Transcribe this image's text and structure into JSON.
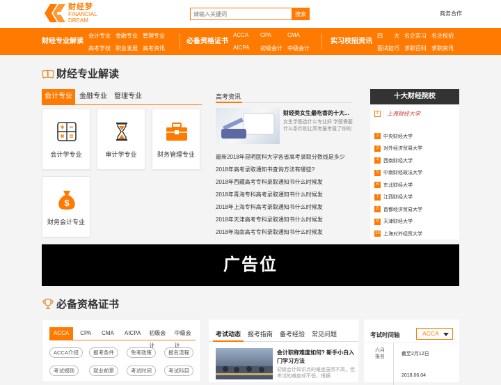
{
  "header": {
    "logo_cn": "财经梦",
    "logo_en_1": "FINANCIAL",
    "logo_en_2": "DREAM",
    "search_placeholder": "请输入关键词",
    "search_button": "搜索",
    "top_link": "商务合作",
    "brand_color": "#ff7a00"
  },
  "nav": {
    "group1_title": "财经专业解读",
    "group1_links": [
      "会计专业",
      "金融专业",
      "管理专业",
      "高考学校",
      "职业发展",
      "高考资讯"
    ],
    "group2_title": "必备资格证书",
    "group2_links": [
      "ACCA",
      "CPA",
      "CMA",
      "AICPA",
      "初级会计",
      "中级会计"
    ],
    "group3_title": "实习校招资讯",
    "group3_links": [
      "四　　大",
      "名企实习",
      "名企校招",
      "面试技巧",
      "求职百科",
      "求职资讯"
    ]
  },
  "majors": {
    "section_title": "财经专业解读",
    "tabs": [
      "会计专业",
      "金融专业",
      "管理专业"
    ],
    "active_tab": 0,
    "cards": [
      {
        "label": "会计学专业",
        "icon": "calculator-icon"
      },
      {
        "label": "审计学专业",
        "icon": "hourglass-icon"
      },
      {
        "label": "财务管理专业",
        "icon": "briefcase-icon"
      },
      {
        "label": "财务会计专业",
        "icon": "money-bag-icon"
      }
    ]
  },
  "news": {
    "title": "高考资讯",
    "featured_title": "财经类女生最吃香的十大...",
    "featured_desc": "女生学医选什么专业好 学医需要什么条件别让高考报考毁了你的",
    "items": [
      "最新2018年昆明医科大学各省高考录取分数线是多少",
      "2018年高考录取通知书查询方法有哪些?",
      "2018年西藏高考专科录取通知书什么时候发",
      "2018年青海专科高考录取通知书什么时候发",
      "2018年上海专科高考录取通知书什么时候发",
      "2018年天津高考专科录取通知书什么时候发",
      "2018年海南高考专科录取通知书什么时候发"
    ]
  },
  "schools": {
    "title": "十大财经院校",
    "first_logo": "上海财经大学",
    "list": [
      "中央财经大学",
      "对外经济贸易大学",
      "西南财经大学",
      "中南财经政法大学",
      "东北财经大学",
      "江西财经大学",
      "首都经济贸易大学",
      "天津财经大学",
      "上海对外经贸大学"
    ]
  },
  "ad": {
    "text": "广告位"
  },
  "certs": {
    "section_title": "必备资格证书",
    "tabs": [
      "ACCA",
      "CPA",
      "CMA",
      "AICPA",
      "初级会计",
      "中级会计"
    ],
    "active_tab": 0,
    "pills_row1": [
      "ACCA介绍",
      "报考条件",
      "免考政策",
      "报名流程"
    ],
    "pills_row2": [
      "考试规则",
      "就业前景",
      "考试时间",
      "考试科目"
    ]
  },
  "exam_news": {
    "tabs": [
      "考试动态",
      "报考指南",
      "备考经验",
      "常见问题"
    ],
    "active_tab": 0,
    "featured_title": "会计职称难度如何? 新手小白入门学习方法",
    "featured_desc": "初级会计知识点的难度虽然不高，但考试的难度却不低，根据"
  },
  "timeline": {
    "title": "考试时间轴",
    "select_value": "ACCA",
    "entries": [
      {
        "month_1": "六月",
        "month_2": "报名",
        "text": "截至2月12日"
      },
      {
        "month_1": "",
        "month_2": "",
        "text": "2018.06.04"
      }
    ]
  }
}
